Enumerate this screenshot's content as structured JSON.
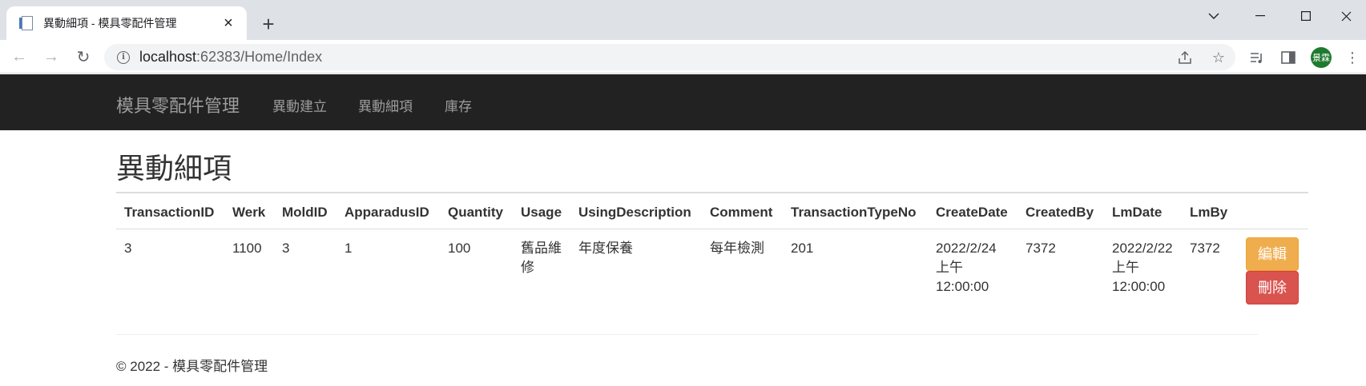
{
  "browser": {
    "tab_title": "異動細項 - 模具零配件管理",
    "url_host": "localhost",
    "url_rest": ":62383/Home/Index",
    "avatar_text": "景霖"
  },
  "navbar": {
    "brand": "模具零配件管理",
    "links": [
      "異動建立",
      "異動細項",
      "庫存"
    ]
  },
  "page": {
    "heading": "異動細項"
  },
  "table": {
    "headers": [
      "TransactionID",
      "Werk",
      "MoldID",
      "ApparadusID",
      "Quantity",
      "Usage",
      "UsingDescription",
      "Comment",
      "TransactionTypeNo",
      "CreateDate",
      "CreatedBy",
      "LmDate",
      "LmBy",
      ""
    ],
    "rows": [
      {
        "TransactionID": "3",
        "Werk": "1100",
        "MoldID": "3",
        "ApparadusID": "1",
        "Quantity": "100",
        "Usage": "舊品維修",
        "UsingDescription": "年度保養",
        "Comment": "每年檢測",
        "TransactionTypeNo": "201",
        "CreateDate": "2022/2/24 上午 12:00:00",
        "CreatedBy": "7372",
        "LmDate": "2022/2/22 上午 12:00:00",
        "LmBy": "7372",
        "edit_label": "編輯",
        "delete_label": "刪除"
      }
    ]
  },
  "footer": {
    "text": "© 2022 - 模具零配件管理"
  },
  "colors": {
    "navbar_bg": "#222222",
    "edit_button": "#f0ad4e",
    "delete_button": "#d9534f"
  }
}
